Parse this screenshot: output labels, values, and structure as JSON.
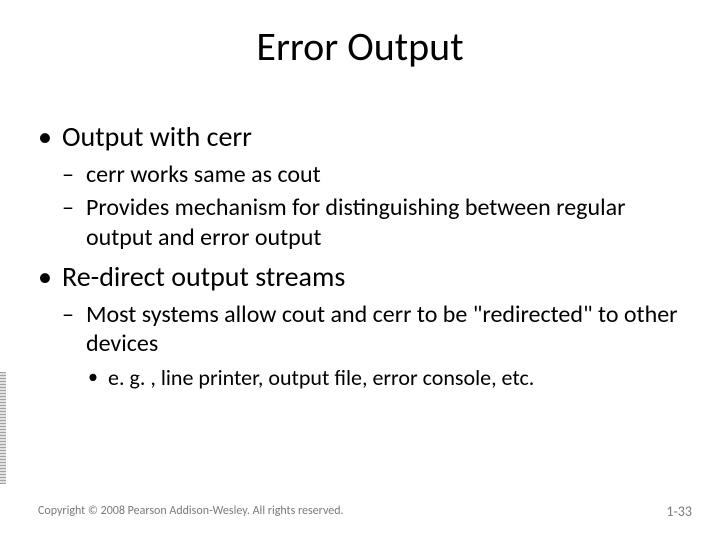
{
  "title": "Error Output",
  "bullets": {
    "b1": "Output with cerr",
    "b1_subs": {
      "s1": "cerr works same as cout",
      "s2": "Provides mechanism for distinguishing between regular output and error output"
    },
    "b2": "Re-direct output streams",
    "b2_subs": {
      "s1": "Most systems allow cout and cerr to be \"redirected\" to other devices",
      "s1_subs": {
        "e1": "e. g. , line printer, output file, error console, etc."
      }
    }
  },
  "footer": {
    "copyright": "Copyright © 2008 Pearson Addison-Wesley. All rights reserved.",
    "page": "1-33"
  }
}
